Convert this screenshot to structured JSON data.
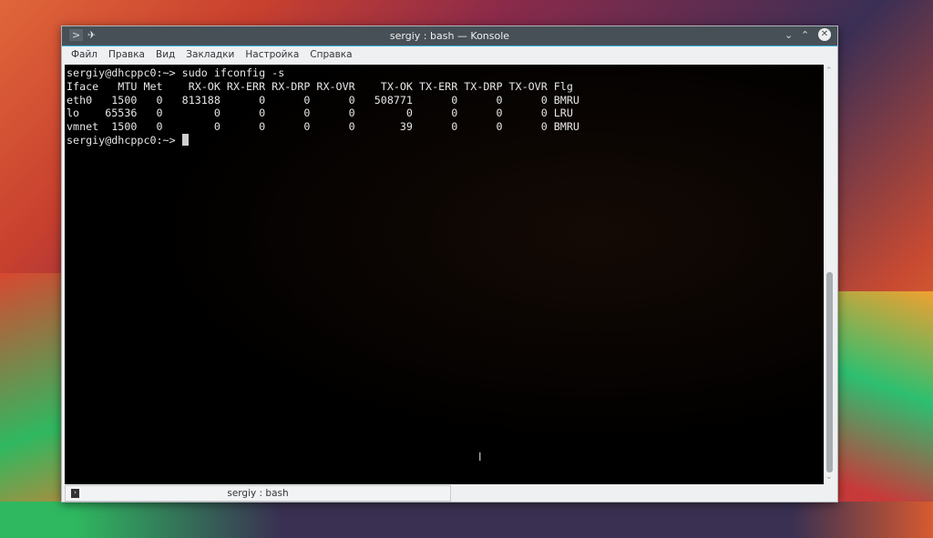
{
  "window": {
    "title": "sergiy : bash — Konsole"
  },
  "menu": [
    "Файл",
    "Правка",
    "Вид",
    "Закладки",
    "Настройка",
    "Справка"
  ],
  "terminal": {
    "lines": [
      "sergiy@dhcppc0:~> sudo ifconfig -s",
      "Iface   MTU Met    RX-OK RX-ERR RX-DRP RX-OVR    TX-OK TX-ERR TX-DRP TX-OVR Flg",
      "eth0   1500   0   813188      0      0      0   508771      0      0      0 BMRU",
      "lo    65536   0        0      0      0      0        0      0      0      0 LRU",
      "vmnet  1500   0        0      0      0      0       39      0      0      0 BMRU"
    ],
    "prompt": "sergiy@dhcppc0:~> "
  },
  "tab": {
    "label": "sergiy : bash"
  }
}
